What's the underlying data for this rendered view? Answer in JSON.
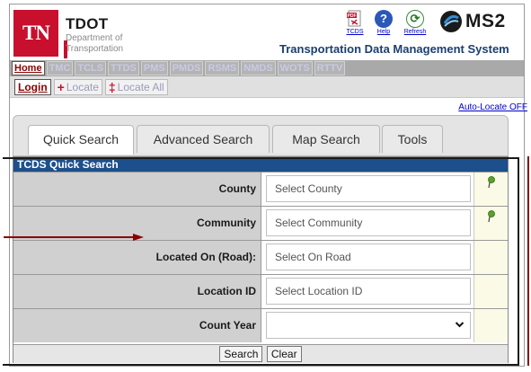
{
  "header": {
    "logo_text": "TN",
    "org_name": "TDOT",
    "org_sub1": "Department of",
    "org_sub2": "Transportation",
    "system_title": "Transportation Data Management System",
    "brand_text": "MS2",
    "icons": [
      {
        "label": "TCDS",
        "icon": "pdf-icon"
      },
      {
        "label": "Help",
        "icon": "help-icon"
      },
      {
        "label": "Refresh",
        "icon": "refresh-icon"
      }
    ]
  },
  "module_nav": {
    "items": [
      "Home",
      "TMC",
      "TCLS",
      "TTDS",
      "PMS",
      "PMDS",
      "RSMS",
      "NMDS",
      "WOTS",
      "RTTV"
    ],
    "active": "Home"
  },
  "toolbar": {
    "login_label": "Login",
    "locate_label": "Locate",
    "locate_all_label": "Locate All",
    "auto_locate_label": "Auto-Locate OFF"
  },
  "tabs": [
    {
      "label": "Quick Search",
      "active": true
    },
    {
      "label": "Advanced Search",
      "active": false
    },
    {
      "label": "Map Search",
      "active": false
    },
    {
      "label": "Tools",
      "active": false
    }
  ],
  "quick_search": {
    "title": "TCDS Quick Search",
    "rows": [
      {
        "label": "County",
        "placeholder": "Select County",
        "has_pin": true
      },
      {
        "label": "Community",
        "placeholder": "Select Community",
        "has_pin": true
      },
      {
        "label": "Located On (Road):",
        "placeholder": "Select On Road",
        "has_pin": false
      },
      {
        "label": "Location ID",
        "placeholder": "Select Location ID",
        "has_pin": false
      },
      {
        "label": "Count Year",
        "placeholder": "",
        "has_pin": false
      }
    ],
    "search_label": "Search",
    "clear_label": "Clear"
  },
  "colors": {
    "brand_red": "#c8102e",
    "header_blue": "#1d4f8c",
    "title_blue": "#1b3f70",
    "callout_red": "#8b0000"
  }
}
